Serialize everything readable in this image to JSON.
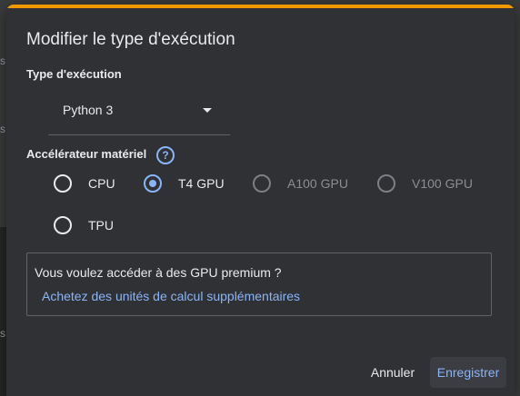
{
  "dialog": {
    "title": "Modifier le type d'exécution",
    "accent_color": "#f29900"
  },
  "runtime": {
    "label": "Type d'exécution",
    "selected": "Python 3"
  },
  "accelerator": {
    "label": "Accélérateur matériel",
    "help_glyph": "?",
    "options": [
      {
        "label": "CPU",
        "checked": false,
        "disabled": false
      },
      {
        "label": "T4 GPU",
        "checked": true,
        "disabled": false
      },
      {
        "label": "A100 GPU",
        "checked": false,
        "disabled": true
      },
      {
        "label": "V100 GPU",
        "checked": false,
        "disabled": true
      },
      {
        "label": "TPU",
        "checked": false,
        "disabled": false
      }
    ]
  },
  "promo": {
    "text": "Vous voulez accéder à des GPU premium ?",
    "link": "Achetez des unités de calcul supplémentaires"
  },
  "actions": {
    "cancel_label": "Annuler",
    "save_label": "Enregistrer"
  },
  "background": {
    "letters": [
      "s",
      "s",
      "s"
    ]
  },
  "colors": {
    "link": "#8ab4f8",
    "surface": "#303134"
  }
}
